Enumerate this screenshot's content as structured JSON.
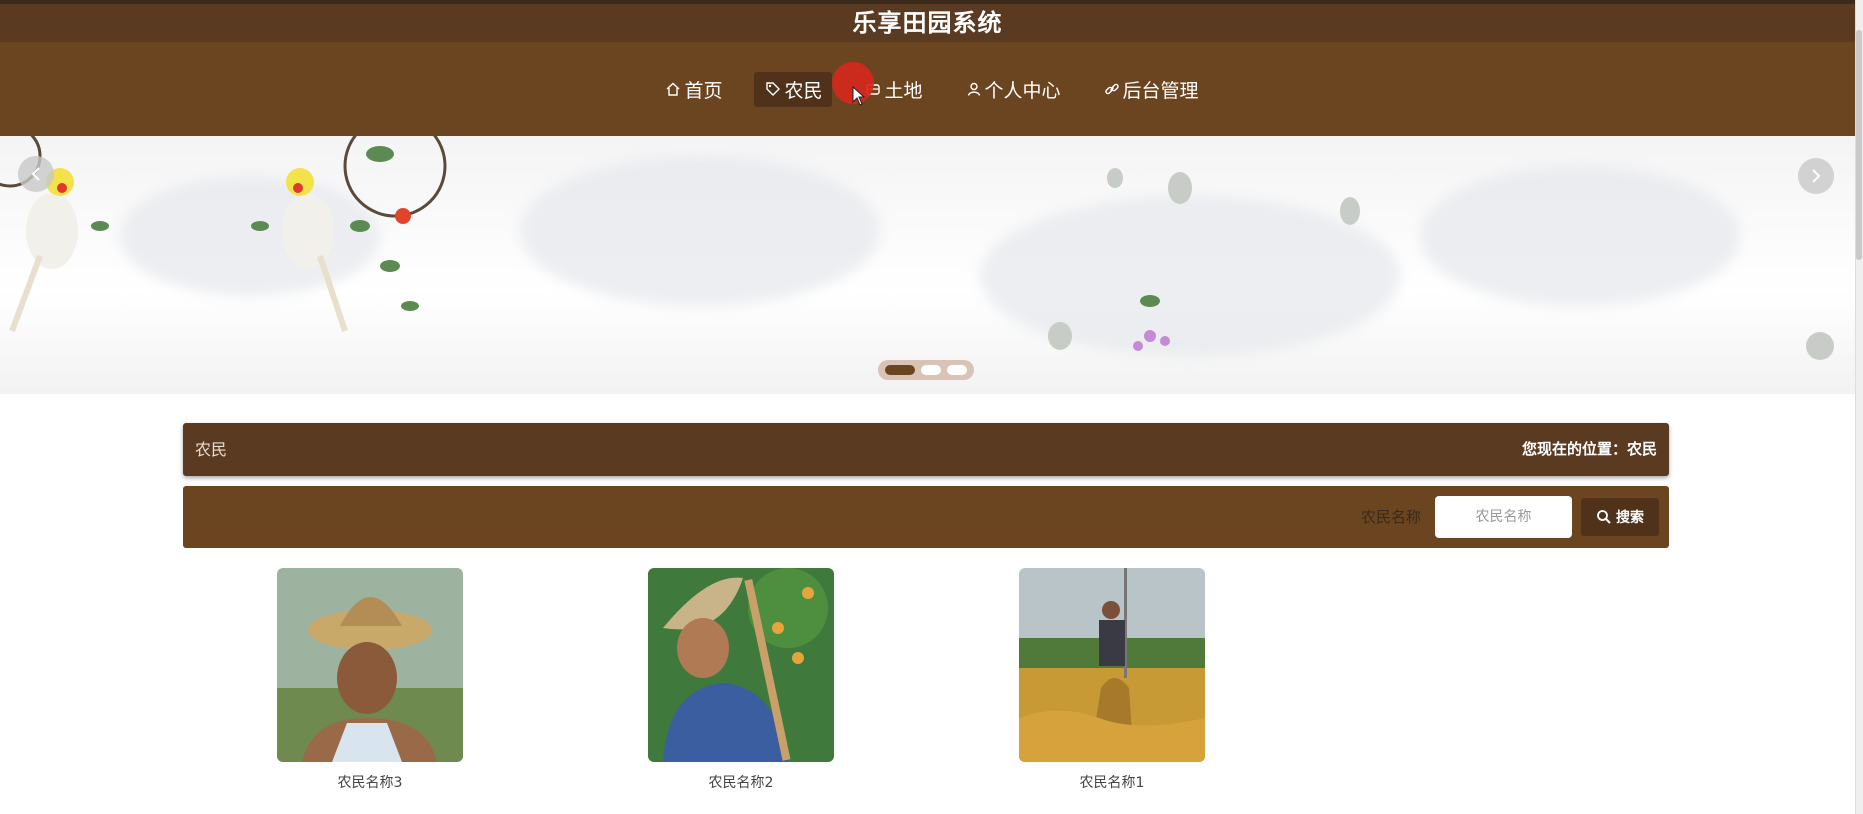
{
  "app": {
    "title": "乐享田园系统"
  },
  "nav": {
    "items": [
      {
        "label": "首页",
        "icon": "home-icon",
        "active": false
      },
      {
        "label": "农民",
        "icon": "tag-icon",
        "active": true
      },
      {
        "label": "土地",
        "icon": "land-icon",
        "active": false
      },
      {
        "label": "个人中心",
        "icon": "user-icon",
        "active": false
      },
      {
        "label": "后台管理",
        "icon": "link-icon",
        "active": false
      }
    ]
  },
  "banner": {
    "slide_count": 3,
    "active_slide": 1
  },
  "breadcrumb": {
    "title": "农民",
    "location": "您现在的位置：农民"
  },
  "search": {
    "label": "农民名称",
    "placeholder": "农民名称",
    "value": "",
    "button_label": "搜索"
  },
  "farmers": [
    {
      "name": "农民名称3"
    },
    {
      "name": "农民名称2"
    },
    {
      "name": "农民名称1"
    }
  ],
  "colors": {
    "header_dark": "#5a3a21",
    "header_mid": "#6b4420",
    "button": "#50321b",
    "accent_red": "#d6281e"
  }
}
